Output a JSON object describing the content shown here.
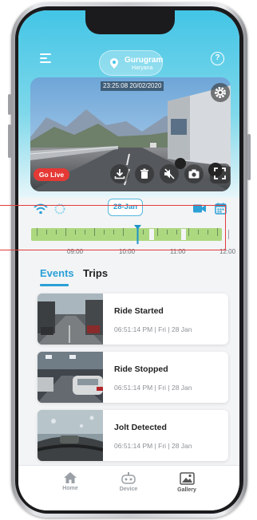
{
  "location": {
    "city": "Gurugram",
    "state": "Haryana"
  },
  "camera": {
    "timestamp": "23:25:08 20/02/2020",
    "go_live_label": "Go Live"
  },
  "toolbar": {
    "date_label": "28-Jan"
  },
  "timeline": {
    "labels": [
      "09:00",
      "10:00",
      "11:00",
      "12:00"
    ],
    "cursor_time": "10:15"
  },
  "tabs": {
    "events_label": "Events",
    "trips_label": "Trips",
    "active": "Events"
  },
  "events": [
    {
      "title": "Ride Started",
      "time": "06:51:14 PM | Fri | 28 Jan"
    },
    {
      "title": "Ride Stopped",
      "time": "06:51:14 PM | Fri | 28 Jan"
    },
    {
      "title": "Jolt Detected",
      "time": "06:51:14 PM | Fri | 28 Jan"
    }
  ],
  "bottom_nav": {
    "home_label": "Home",
    "device_label": "Device",
    "gallery_label": "Gallery",
    "active": "Gallery"
  },
  "colors": {
    "accent": "#2aa0d6",
    "header_top": "#43c5e6",
    "live_red": "#e53935",
    "timeline_green": "#acd880",
    "highlight": "#e23b3b"
  },
  "icons": [
    "menu-icon",
    "location-pin-icon",
    "help-icon",
    "settings-gear-icon",
    "download-icon",
    "trash-icon",
    "mute-icon",
    "camera-icon",
    "fullscreen-icon",
    "wifi-icon",
    "loading-icon",
    "video-camera-icon",
    "calendar-icon",
    "home-icon",
    "device-icon",
    "gallery-icon"
  ]
}
